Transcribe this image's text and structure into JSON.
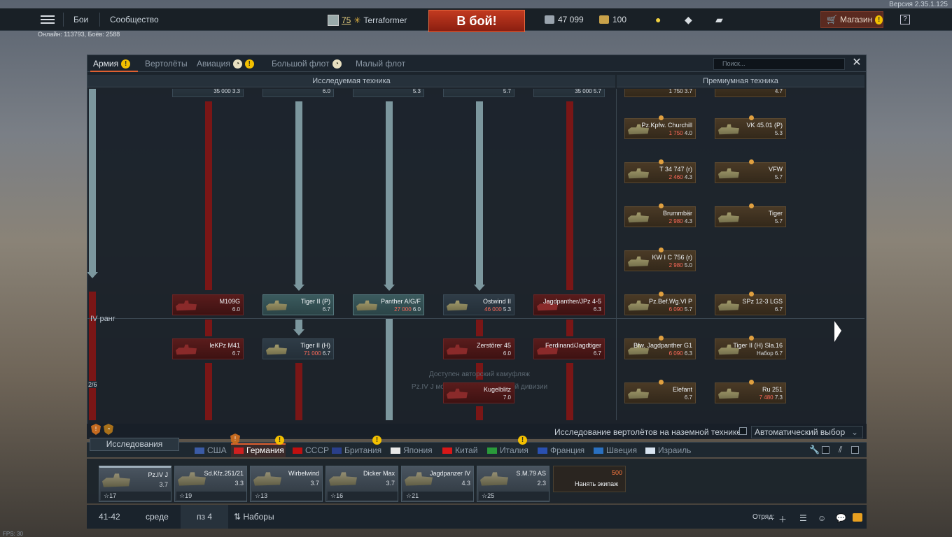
{
  "version": "Версия 2.35.1.125",
  "topbar": {
    "nav": [
      "Бои",
      "Сообщество"
    ],
    "profile": {
      "level": "75",
      "name": "Terraformer"
    },
    "battle_button": "В бой!",
    "silver": "47 099",
    "gold": "100",
    "shop": "Магазин",
    "help": "?"
  },
  "online": "Онлайн: 113793, Боёв: 2588",
  "window": {
    "tabs": [
      {
        "label": "Армия",
        "warn": true,
        "timer": false
      },
      {
        "label": "Вертолёты",
        "warn": false,
        "timer": false
      },
      {
        "label": "Авиация",
        "warn": true,
        "timer": true
      },
      {
        "label": "Большой флот",
        "warn": false,
        "timer": true
      },
      {
        "label": "Малый флот",
        "warn": false,
        "timer": false
      }
    ],
    "search_placeholder": "Поиск...",
    "col_research": "Исследуемая техника",
    "col_premium": "Премиумная техника",
    "rank_label": "IV ранг",
    "rank_progress": "2/6",
    "camo_note_1": "Доступен авторский камуфляж",
    "camo_note_2": "Pz.IV J модель '211' 6-й танковой дивизии"
  },
  "tree_top": [
    {
      "meta": "35 000 3.3"
    },
    {
      "meta": "6.0"
    },
    {
      "meta": "5.3"
    },
    {
      "meta": "5.7"
    },
    {
      "meta": "35 000 5.7"
    }
  ],
  "tree": [
    {
      "name": "M109G",
      "meta": "6.0",
      "cost": "",
      "state": "locked",
      "col": 0,
      "row": 0
    },
    {
      "name": "Tiger II (P)",
      "meta": "6.7",
      "cost": "",
      "state": "researched",
      "col": 1,
      "row": 0
    },
    {
      "name": "Panther A/G/F",
      "meta": "6.0",
      "cost": "27 000",
      "state": "researched",
      "col": 2,
      "row": 0
    },
    {
      "name": "Ostwind II",
      "meta": "5.3",
      "cost": "46 000",
      "state": "normal",
      "col": 3,
      "row": 0
    },
    {
      "name": "Jagdpanther/JPz 4-5",
      "meta": "6.3",
      "cost": "",
      "state": "locked",
      "col": 4,
      "row": 0
    },
    {
      "name": "leKPz M41",
      "meta": "6.7",
      "cost": "",
      "state": "locked",
      "col": 0,
      "row": 1
    },
    {
      "name": "Tiger II (H)",
      "meta": "6.7",
      "cost": "71 000",
      "state": "normal",
      "col": 1,
      "row": 1
    },
    {
      "name": "Zerstörer 45",
      "meta": "6.0",
      "cost": "",
      "state": "locked",
      "col": 3,
      "row": 1
    },
    {
      "name": "Ferdinand/Jagdtiger",
      "meta": "6.7",
      "cost": "",
      "state": "locked",
      "col": 4,
      "row": 1
    },
    {
      "name": "Kugelblitz",
      "meta": "7.0",
      "cost": "",
      "state": "locked",
      "col": 3,
      "row": 2
    }
  ],
  "premium_top": [
    {
      "meta": "1 750 3.7"
    },
    {
      "meta": "4.7"
    }
  ],
  "premium": [
    {
      "name": "Pz.Kpfw. Churchill",
      "meta": "4.0",
      "cost": "1 750",
      "col": 0,
      "row": 0
    },
    {
      "name": "VK 45.01 (P)",
      "meta": "5.3",
      "cost": "",
      "col": 1,
      "row": 0
    },
    {
      "name": "T 34 747 (r)",
      "meta": "4.3",
      "cost": "2 460",
      "col": 0,
      "row": 1
    },
    {
      "name": "VFW",
      "meta": "5.7",
      "cost": "",
      "col": 1,
      "row": 1
    },
    {
      "name": "Brummbär",
      "meta": "4.3",
      "cost": "2 980",
      "col": 0,
      "row": 2
    },
    {
      "name": "Tiger",
      "meta": "5.7",
      "cost": "",
      "col": 1,
      "row": 2
    },
    {
      "name": "KW I C 756 (r)",
      "meta": "5.0",
      "cost": "2 980",
      "col": 0,
      "row": 3
    },
    {
      "name": "Pz.Bef.Wg.VI P",
      "meta": "5.7",
      "cost": "6 090",
      "col": 0,
      "row": 4
    },
    {
      "name": "SPz 12-3 LGS",
      "meta": "6.7",
      "cost": "",
      "col": 1,
      "row": 4
    },
    {
      "name": "Bfw. Jagdpanther G1",
      "meta": "6.3",
      "cost": "6 090",
      "col": 0,
      "row": 5
    },
    {
      "name": "Tiger II (H) Sla.16",
      "meta": "Набор 6.7",
      "cost": "",
      "col": 1,
      "row": 5
    },
    {
      "name": "Elefant",
      "meta": "6.7",
      "cost": "",
      "col": 0,
      "row": 6
    },
    {
      "name": "Ru 251",
      "meta": "7.3",
      "cost": "7 480",
      "col": 1,
      "row": 6
    }
  ],
  "heli_research": "Исследование вертолётов на наземной технике",
  "auto_select": "Автоматический выбор",
  "research_button": "Исследования",
  "nations": [
    {
      "label": "США",
      "color": "#3b5ba5"
    },
    {
      "label": "Германия",
      "color": "#d02020"
    },
    {
      "label": "СССР",
      "color": "#c01010"
    },
    {
      "label": "Британия",
      "color": "#2a3f8a"
    },
    {
      "label": "Япония",
      "color": "#e8e8e8"
    },
    {
      "label": "Китай",
      "color": "#d81818"
    },
    {
      "label": "Италия",
      "color": "#2a9a3a"
    },
    {
      "label": "Франция",
      "color": "#2a50b0"
    },
    {
      "label": "Швеция",
      "color": "#2a70c0"
    },
    {
      "label": "Израиль",
      "color": "#d8e4f0"
    }
  ],
  "crew": [
    {
      "name": "Pz.IV J",
      "br": "3.7",
      "crew": "17"
    },
    {
      "name": "Sd.Kfz.251/21",
      "br": "3.3",
      "crew": "19"
    },
    {
      "name": "Wirbelwind",
      "br": "3.7",
      "crew": "13"
    },
    {
      "name": "Dicker Max",
      "br": "3.7",
      "crew": "16"
    },
    {
      "name": "Jagdpanzer IV",
      "br": "4.3",
      "crew": "21"
    },
    {
      "name": "S.M.79 AS",
      "br": "2.3",
      "crew": "25"
    }
  ],
  "hire": {
    "cost": "500",
    "label": "Нанять экипаж"
  },
  "bottom": {
    "a": "41-42",
    "b": "среде",
    "c": "пз 4",
    "presets": "Наборы",
    "squad": "Отряд:"
  },
  "fps": "FPS: 30"
}
